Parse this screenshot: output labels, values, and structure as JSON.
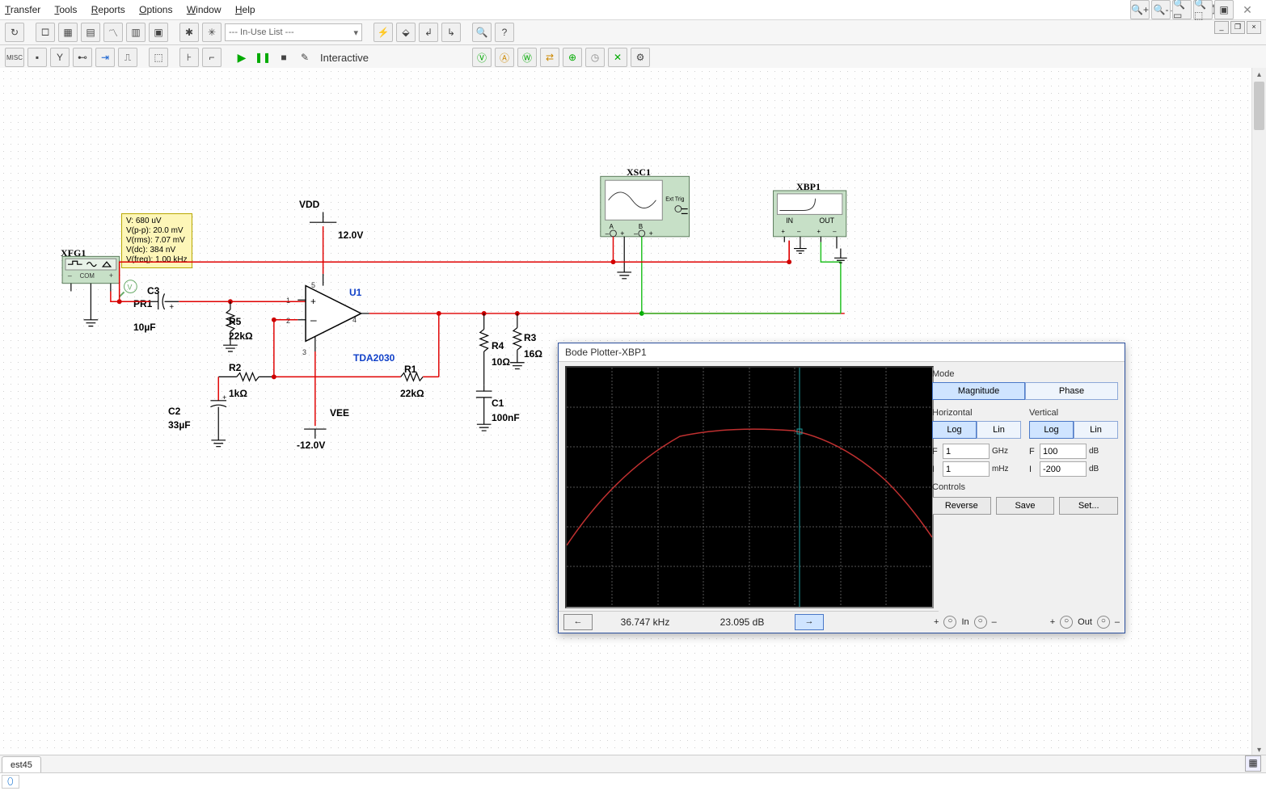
{
  "menu": {
    "transfer": "Transfer",
    "tools": "Tools",
    "reports": "Reports",
    "options": "Options",
    "window": "Window",
    "help": "Help"
  },
  "window_controls": {
    "min": "—",
    "max": "🗖",
    "close": "✕"
  },
  "mdi_controls": {
    "min": "_",
    "max": "❐",
    "close": "×"
  },
  "toolbar1": {
    "inuse_placeholder": "--- In-Use List ---"
  },
  "toolbar2": {
    "interactive": "Interactive"
  },
  "probe": {
    "line1": "V: 680 uV",
    "line2": "V(p-p): 20.0 mV",
    "line3": "V(rms): 7.07 mV",
    "line4": "V(dc): 384 nV",
    "line5": "V(freq): 1.00 kHz"
  },
  "schematic": {
    "xfg1": "XFG1",
    "xsc1": "XSC1",
    "xbp1": "XBP1",
    "com": "COM",
    "ext_trig": "Ext Trig",
    "a": "A",
    "b": "B",
    "in": "IN",
    "out": "OUT",
    "vdd": "VDD",
    "vdd_val": "12.0V",
    "vee": "VEE",
    "vee_val": "-12.0V",
    "u1": "U1",
    "chip": "TDA2030",
    "c1": "C1",
    "c1v": "100nF",
    "c2": "C2",
    "c2v": "33µF",
    "c3": "C3",
    "c3v": "10µF",
    "r1": "R1",
    "r1v": "22kΩ",
    "r2": "R2",
    "r2v": "1kΩ",
    "r3": "R3",
    "r3v": "16Ω",
    "r4": "R4",
    "r4v": "10Ω",
    "r5": "R5",
    "r5v": "22kΩ",
    "pr1": "PR1",
    "pin1": "1",
    "pin2": "2",
    "pin3": "3",
    "pin4": "4",
    "pin5": "5",
    "plus": "+",
    "minus": "–"
  },
  "bode": {
    "title": "Bode Plotter-XBP1",
    "mode": "Mode",
    "magnitude": "Magnitude",
    "phase": "Phase",
    "horizontal": "Horizontal",
    "vertical": "Vertical",
    "log": "Log",
    "lin": "Lin",
    "hf_f": "F",
    "hf_val": "1",
    "hf_unit": "GHz",
    "hi_i": "I",
    "hi_val": "1",
    "hi_unit": "mHz",
    "vf_f": "F",
    "vf_val": "100",
    "vf_unit": "dB",
    "vi_i": "I",
    "vi_val": "-200",
    "vi_unit": "dB",
    "controls": "Controls",
    "reverse": "Reverse",
    "save": "Save",
    "set": "Set...",
    "freq_readout": "36.747 kHz",
    "mag_readout": "23.095 dB",
    "io_in": "In",
    "io_out": "Out",
    "io_plus": "+",
    "io_minus": "–",
    "arrow_left": "←",
    "arrow_right": "→"
  },
  "tabs": {
    "t1": "est45"
  },
  "status": {
    "db": "⬯"
  }
}
